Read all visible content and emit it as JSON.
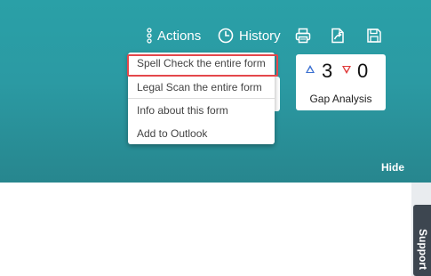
{
  "toolbar": {
    "actions_label": "Actions",
    "history_label": "History",
    "icons": {
      "actions": "vertical-dots-icon",
      "history": "clock-icon",
      "print": "printer-icon",
      "export": "export-pdf-icon",
      "save": "floppy-disk-icon"
    }
  },
  "actions_menu": {
    "items": [
      {
        "label": "Spell Check the entire form",
        "highlighted": true
      },
      {
        "label": "Legal Scan the entire form"
      },
      {
        "label": "Info about this form"
      },
      {
        "label": "Add to Outlook"
      }
    ]
  },
  "gap_analysis": {
    "up_value": "3",
    "down_value": "0",
    "title": "Gap Analysis",
    "up_color": "#3a6fd0",
    "down_color": "#e03a3a"
  },
  "hide_label": "Hide",
  "support_label": "Support",
  "colors": {
    "header_teal": "#2aa0a7",
    "highlight_red": "#e4474b",
    "support_tab": "#3d4650"
  }
}
